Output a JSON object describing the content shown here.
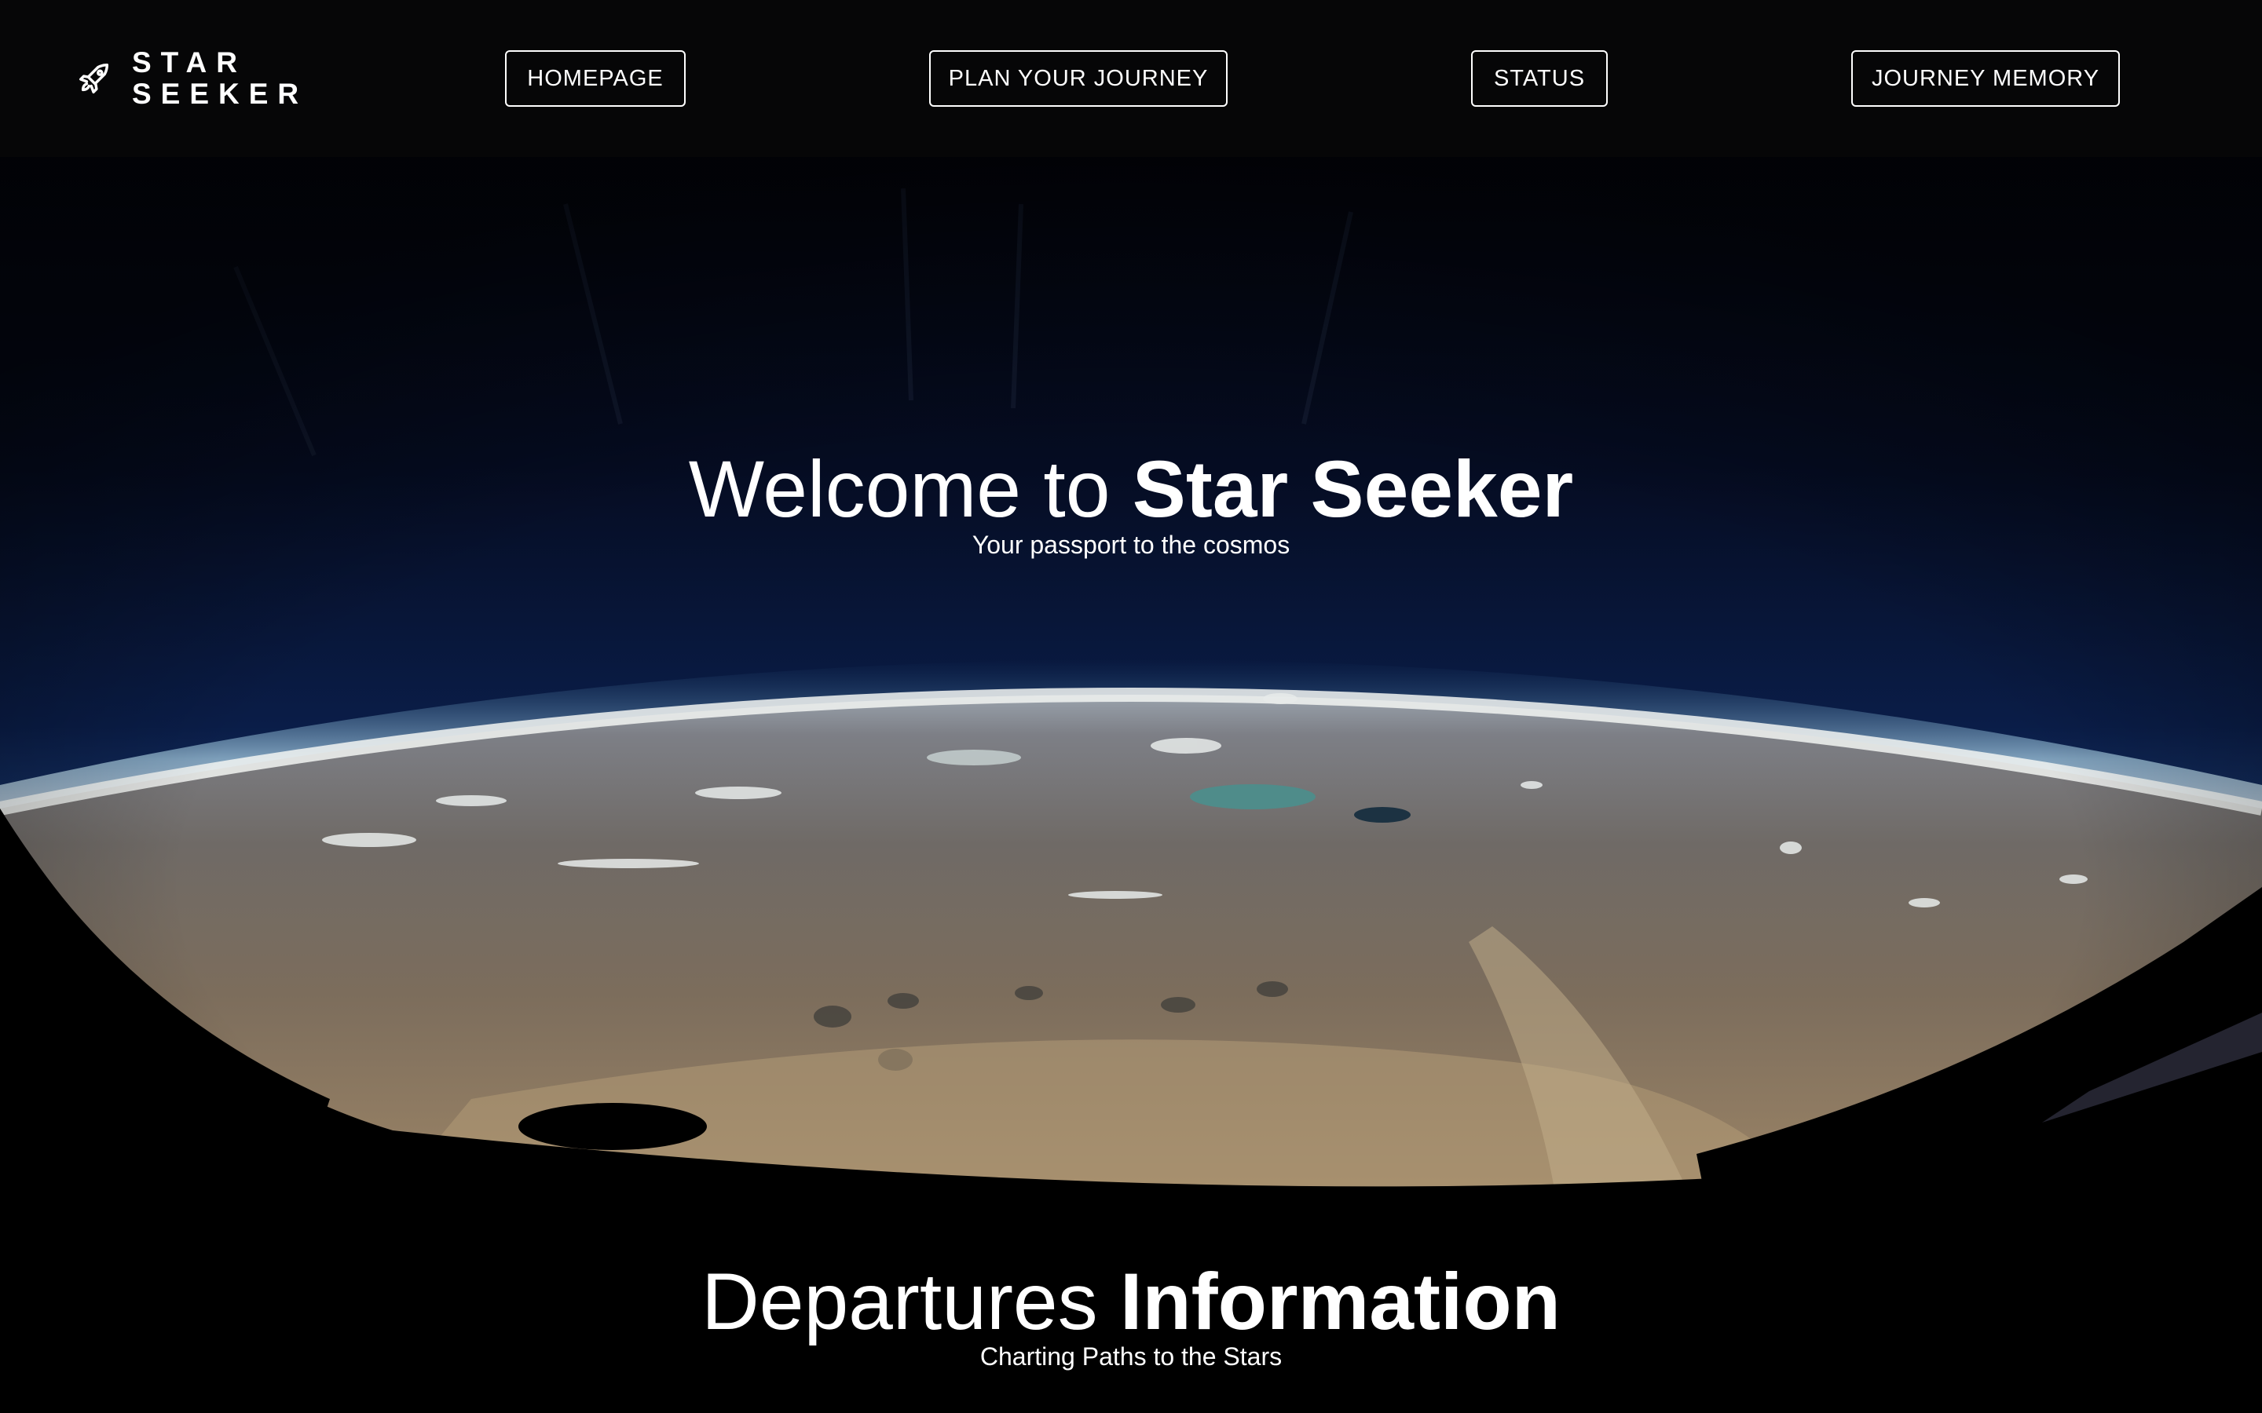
{
  "brand": {
    "line1": "STAR",
    "line2": "SEEKER",
    "icon": "rocket-icon"
  },
  "nav": {
    "home": "HOMEPAGE",
    "plan": "PLAN YOUR JOURNEY",
    "status": "STATUS",
    "memory": "JOURNEY MEMORY"
  },
  "hero": {
    "title_light": "Welcome to ",
    "title_bold": "Star Seeker",
    "subtitle": "Your passport to the cosmos",
    "image": "earth-from-spacecraft-window"
  },
  "departures": {
    "title_light": "Departures ",
    "title_bold": "Information",
    "subtitle": "Charting Paths to the Stars"
  },
  "colors": {
    "background": "#000000",
    "header": "#060607",
    "text": "#ffffff",
    "space_blue": "#0a1d48",
    "earth_tan": "#8a7560"
  }
}
